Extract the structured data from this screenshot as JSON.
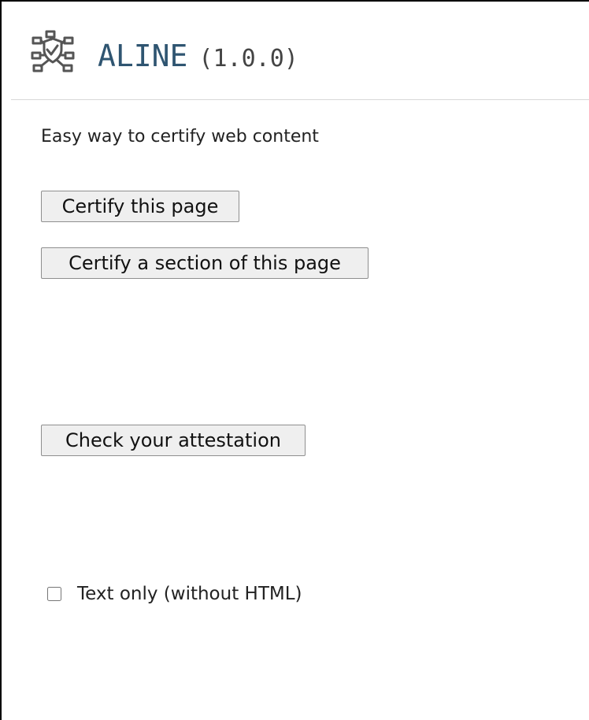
{
  "header": {
    "logo_icon": "certificate-shield-network-icon",
    "title": "ALINE",
    "version": "(1.0.0)"
  },
  "main": {
    "tagline": "Easy way to certify web content",
    "certify_page_label": "Certify this page",
    "certify_section_label": "Certify a section of this page",
    "check_attestation_label": "Check your attestation"
  },
  "options": {
    "text_only_label": "Text only (without HTML)",
    "text_only_checked": false
  },
  "colors": {
    "title": "#2f5571",
    "button_background": "#efefef",
    "button_border": "#8f8f8f"
  }
}
